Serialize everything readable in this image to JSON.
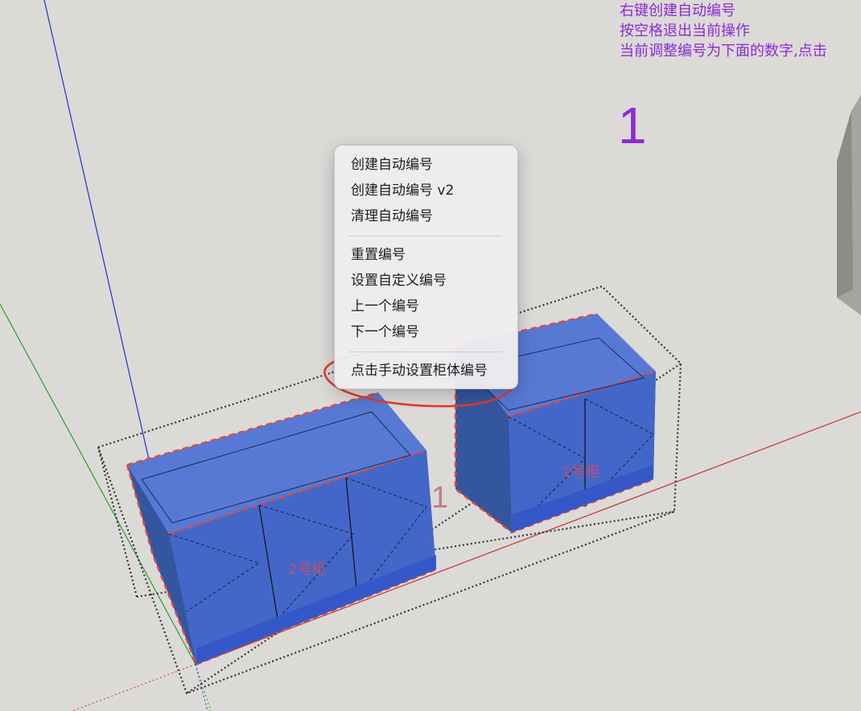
{
  "hints": {
    "line1": "右键创建自动编号",
    "line2": "按空格退出当前操作",
    "line3": "当前调整编号为下面的数字,点击"
  },
  "current_number": "1",
  "context_menu": {
    "items": [
      {
        "label": "创建自动编号"
      },
      {
        "label": "创建自动编号 v2"
      },
      {
        "label": "清理自动编号"
      },
      {
        "label": "重置编号"
      },
      {
        "label": "设置自定义编号"
      },
      {
        "label": "上一个编号"
      },
      {
        "label": "下一个编号"
      },
      {
        "label": "点击手动设置柜体编号"
      }
    ]
  },
  "cabinets": {
    "cabinet_1_label": "1号柜",
    "cabinet_2_label": "2号柜",
    "floating_number": "1"
  },
  "colors": {
    "accent_text": "#8a2bd6",
    "cabinet_fill": "#3f64c8",
    "highlight_circle": "#e23b2a"
  }
}
